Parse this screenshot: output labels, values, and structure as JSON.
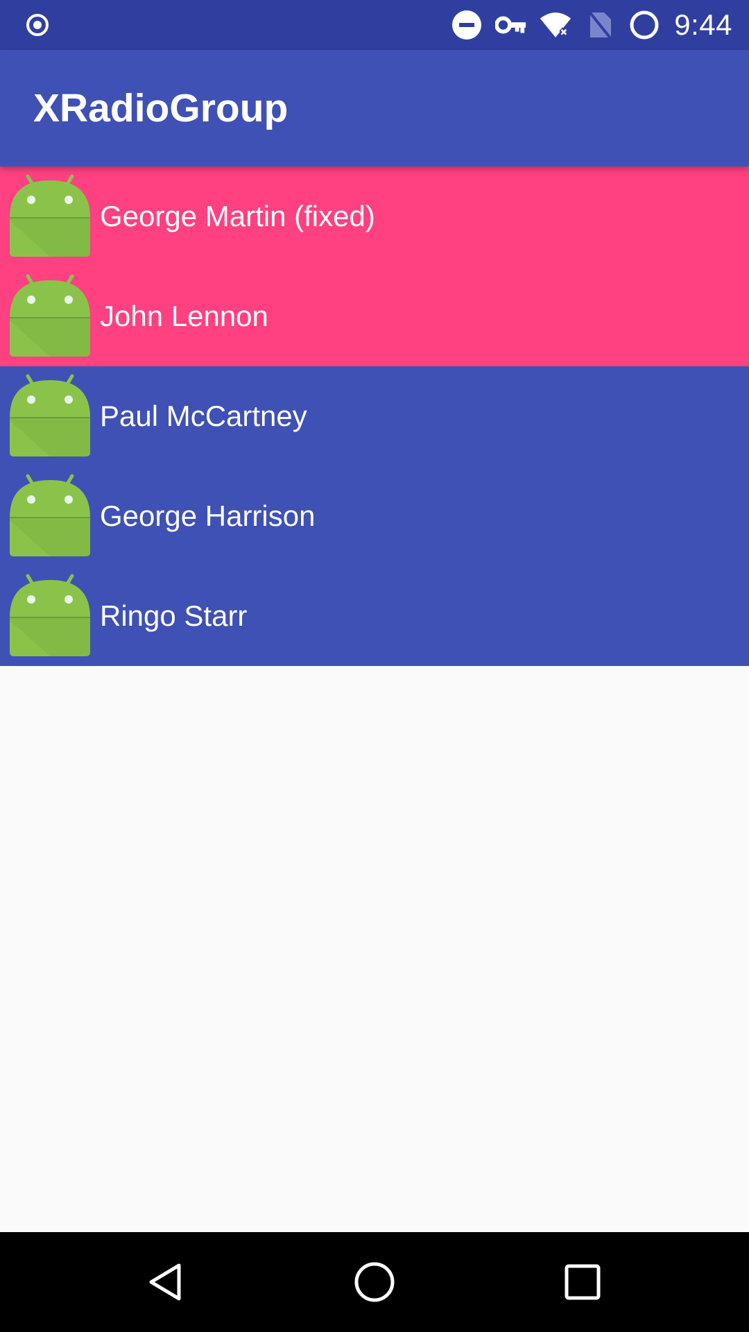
{
  "status_bar": {
    "time": "9:44",
    "icons": [
      "radio-button-icon",
      "do-not-disturb-icon",
      "vpn-key-icon",
      "wifi-off-icon",
      "no-sim-icon",
      "battery-circle-icon"
    ]
  },
  "app_bar": {
    "title": "XRadioGroup"
  },
  "list": {
    "items": [
      {
        "label": "George Martin (fixed)",
        "checked": true,
        "icon": "android-icon"
      },
      {
        "label": "John Lennon",
        "checked": true,
        "icon": "android-icon"
      },
      {
        "label": "Paul McCartney",
        "checked": false,
        "icon": "android-icon"
      },
      {
        "label": "George Harrison",
        "checked": false,
        "icon": "android-icon"
      },
      {
        "label": "Ringo Starr",
        "checked": false,
        "icon": "android-icon"
      }
    ]
  },
  "nav_bar": {
    "buttons": [
      "back-icon",
      "home-icon",
      "recents-icon"
    ]
  },
  "colors": {
    "primary": "#3F51B5",
    "primary_dark": "#303F9F",
    "accent": "#FF4081",
    "android_green": "#8BC34A",
    "background": "#FAFAFA"
  }
}
